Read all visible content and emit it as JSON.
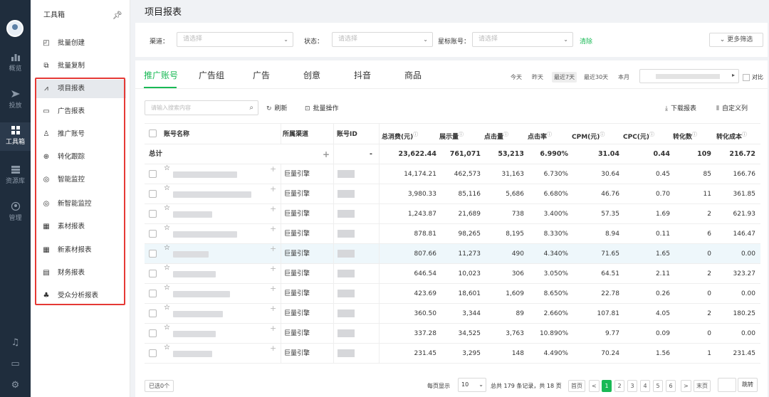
{
  "rail": {
    "items": [
      {
        "label": "概览",
        "icon": "bar-chart-icon"
      },
      {
        "label": "投放",
        "icon": "send-icon"
      },
      {
        "label": "工具箱",
        "icon": "grid-icon"
      },
      {
        "label": "资源库",
        "icon": "database-icon"
      },
      {
        "label": "管理",
        "icon": "user-icon"
      }
    ]
  },
  "sidebar": {
    "title": "工具箱",
    "items": [
      {
        "label": "批量创建",
        "icon": "◰"
      },
      {
        "label": "批量复制",
        "icon": "⧉"
      },
      {
        "label": "项目报表",
        "icon": "⩘"
      },
      {
        "label": "广告报表",
        "icon": "▭"
      },
      {
        "label": "推广账号",
        "icon": "♙"
      },
      {
        "label": "转化跟踪",
        "icon": "⊕"
      },
      {
        "label": "智能监控",
        "icon": "◎"
      },
      {
        "label": "新智能监控",
        "icon": "◎"
      },
      {
        "label": "素材报表",
        "icon": "▦"
      },
      {
        "label": "新素材报表",
        "icon": "▦"
      },
      {
        "label": "财务报表",
        "icon": "▤"
      },
      {
        "label": "受众分析报表",
        "icon": "♣"
      }
    ]
  },
  "page": {
    "title": "项目报表"
  },
  "filters": {
    "channel_label": "渠道：",
    "channel_ph": "请选择",
    "status_label": "状态：",
    "status_ph": "请选择",
    "star_label": "星标账号：",
    "star_ph": "请选择",
    "clear": "清除",
    "more": "更多筛选"
  },
  "tabs": [
    "推广账号",
    "广告组",
    "广告",
    "创意",
    "抖音",
    "商品"
  ],
  "date_tabs": [
    "今天",
    "昨天",
    "最近7天",
    "最近30天",
    "本月"
  ],
  "compare": "对比",
  "toolbar": {
    "search_ph": "请输入搜索内容",
    "refresh": "刷新",
    "batch": "批量操作",
    "download": "下载报表",
    "custom_cols": "自定义列"
  },
  "table": {
    "headers": [
      "账号名称",
      "所属渠道",
      "账号ID",
      "总消费(元)",
      "展示量",
      "点击量",
      "点击率",
      "CPM(元)",
      "CPC(元)",
      "转化数",
      "转化成本"
    ],
    "total": {
      "label": "总计",
      "id": "-",
      "values": [
        "23,622.44",
        "761,071",
        "53,213",
        "6.990%",
        "31.04",
        "0.44",
        "109",
        "216.72"
      ]
    },
    "rows": [
      {
        "channel": "巨量引擎",
        "values": [
          "14,174.21",
          "462,573",
          "31,163",
          "6.730%",
          "30.64",
          "0.45",
          "85",
          "166.76"
        ]
      },
      {
        "channel": "巨量引擎",
        "values": [
          "3,980.33",
          "85,116",
          "5,686",
          "6.680%",
          "46.76",
          "0.70",
          "11",
          "361.85"
        ]
      },
      {
        "channel": "巨量引擎",
        "values": [
          "1,243.87",
          "21,689",
          "738",
          "3.400%",
          "57.35",
          "1.69",
          "2",
          "621.93"
        ]
      },
      {
        "channel": "巨量引擎",
        "values": [
          "878.81",
          "98,265",
          "8,195",
          "8.330%",
          "8.94",
          "0.11",
          "6",
          "146.47"
        ]
      },
      {
        "channel": "巨量引擎",
        "values": [
          "807.66",
          "11,273",
          "490",
          "4.340%",
          "71.65",
          "1.65",
          "0",
          "0.00"
        ]
      },
      {
        "channel": "巨量引擎",
        "values": [
          "646.54",
          "10,023",
          "306",
          "3.050%",
          "64.51",
          "2.11",
          "2",
          "323.27"
        ]
      },
      {
        "channel": "巨量引擎",
        "values": [
          "423.69",
          "18,601",
          "1,609",
          "8.650%",
          "22.78",
          "0.26",
          "0",
          "0.00"
        ]
      },
      {
        "channel": "巨量引擎",
        "values": [
          "360.50",
          "3,344",
          "89",
          "2.660%",
          "107.81",
          "4.05",
          "2",
          "180.25"
        ]
      },
      {
        "channel": "巨量引擎",
        "values": [
          "337.28",
          "34,525",
          "3,763",
          "10.890%",
          "9.77",
          "0.09",
          "0",
          "0.00"
        ]
      },
      {
        "channel": "巨量引擎",
        "values": [
          "231.45",
          "3,295",
          "148",
          "4.490%",
          "70.24",
          "1.56",
          "1",
          "231.45"
        ]
      }
    ]
  },
  "footer": {
    "selected": "已选0个",
    "per_page_label": "每页显示",
    "per_page": "10",
    "summary": "总共 179 条记录，共 18 页",
    "first": "首页",
    "prev": "<",
    "pages": [
      "1",
      "2",
      "3",
      "4",
      "5",
      "6"
    ],
    "next": ">",
    "last": "末页",
    "jump": "跳转"
  },
  "colors": {
    "accent": "#19b955",
    "rail": "#1f2d3d",
    "highlight": "#e53935"
  }
}
